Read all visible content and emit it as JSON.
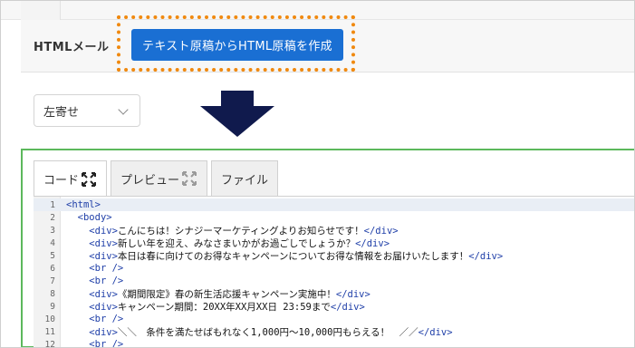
{
  "header": {
    "label": "HTMLメール",
    "convert_button": "テキスト原稿からHTML原稿を作成"
  },
  "align_select": {
    "value": "左寄せ"
  },
  "editor": {
    "tabs": [
      {
        "label": "コード",
        "active": true
      },
      {
        "label": "プレビュー",
        "active": false
      },
      {
        "label": "ファイル",
        "active": false
      }
    ],
    "lines": [
      {
        "num": "1",
        "indent": "",
        "parts": [
          [
            "tag",
            "<html>"
          ]
        ]
      },
      {
        "num": "2",
        "indent": "  ",
        "parts": [
          [
            "tag",
            "<body>"
          ]
        ]
      },
      {
        "num": "3",
        "indent": "    ",
        "parts": [
          [
            "tag",
            "<div>"
          ],
          [
            "txt",
            "こんにちは！シナジーマーケティングよりお知らせです！"
          ],
          [
            "tag",
            "</div>"
          ]
        ]
      },
      {
        "num": "4",
        "indent": "    ",
        "parts": [
          [
            "tag",
            "<div>"
          ],
          [
            "txt",
            "新しい年を迎え、みなさまいかがお過ごしでしょうか？"
          ],
          [
            "tag",
            "</div>"
          ]
        ]
      },
      {
        "num": "5",
        "indent": "    ",
        "parts": [
          [
            "tag",
            "<div>"
          ],
          [
            "txt",
            "本日は春に向けてのお得なキャンペーンについてお得な情報をお届けいたします！"
          ],
          [
            "tag",
            "</div>"
          ]
        ]
      },
      {
        "num": "6",
        "indent": "    ",
        "parts": [
          [
            "tag",
            "<br />"
          ]
        ]
      },
      {
        "num": "7",
        "indent": "    ",
        "parts": [
          [
            "tag",
            "<br />"
          ]
        ]
      },
      {
        "num": "8",
        "indent": "    ",
        "parts": [
          [
            "tag",
            "<div>"
          ],
          [
            "txt",
            "《期間限定》春の新生活応援キャンペーン実施中！"
          ],
          [
            "tag",
            "</div>"
          ]
        ]
      },
      {
        "num": "9",
        "indent": "    ",
        "parts": [
          [
            "tag",
            "<div>"
          ],
          [
            "txt",
            "キャンペーン期間：20XX年XX月XX日 23:59まで"
          ],
          [
            "tag",
            "</div>"
          ]
        ]
      },
      {
        "num": "10",
        "indent": "    ",
        "parts": [
          [
            "tag",
            "<br />"
          ]
        ]
      },
      {
        "num": "11",
        "indent": "    ",
        "parts": [
          [
            "tag",
            "<div>"
          ],
          [
            "txt",
            "＼＼　条件を満たせばもれなく1,000円～10,000円もらえる！　／／"
          ],
          [
            "tag",
            "</div>"
          ]
        ]
      },
      {
        "num": "12",
        "indent": "    ",
        "parts": [
          [
            "tag",
            "<br />"
          ]
        ]
      }
    ]
  },
  "colors": {
    "button_blue": "#1a6fd3",
    "highlight_orange": "#f0890f",
    "arrow_navy": "#101a4d",
    "editor_border_green": "#5cb85c",
    "tag_blue": "#1f3fa8"
  },
  "icons": {
    "expand": "expand-arrows-icon",
    "arrow": "down-arrow-icon",
    "chevron": "chevron-down-icon"
  }
}
